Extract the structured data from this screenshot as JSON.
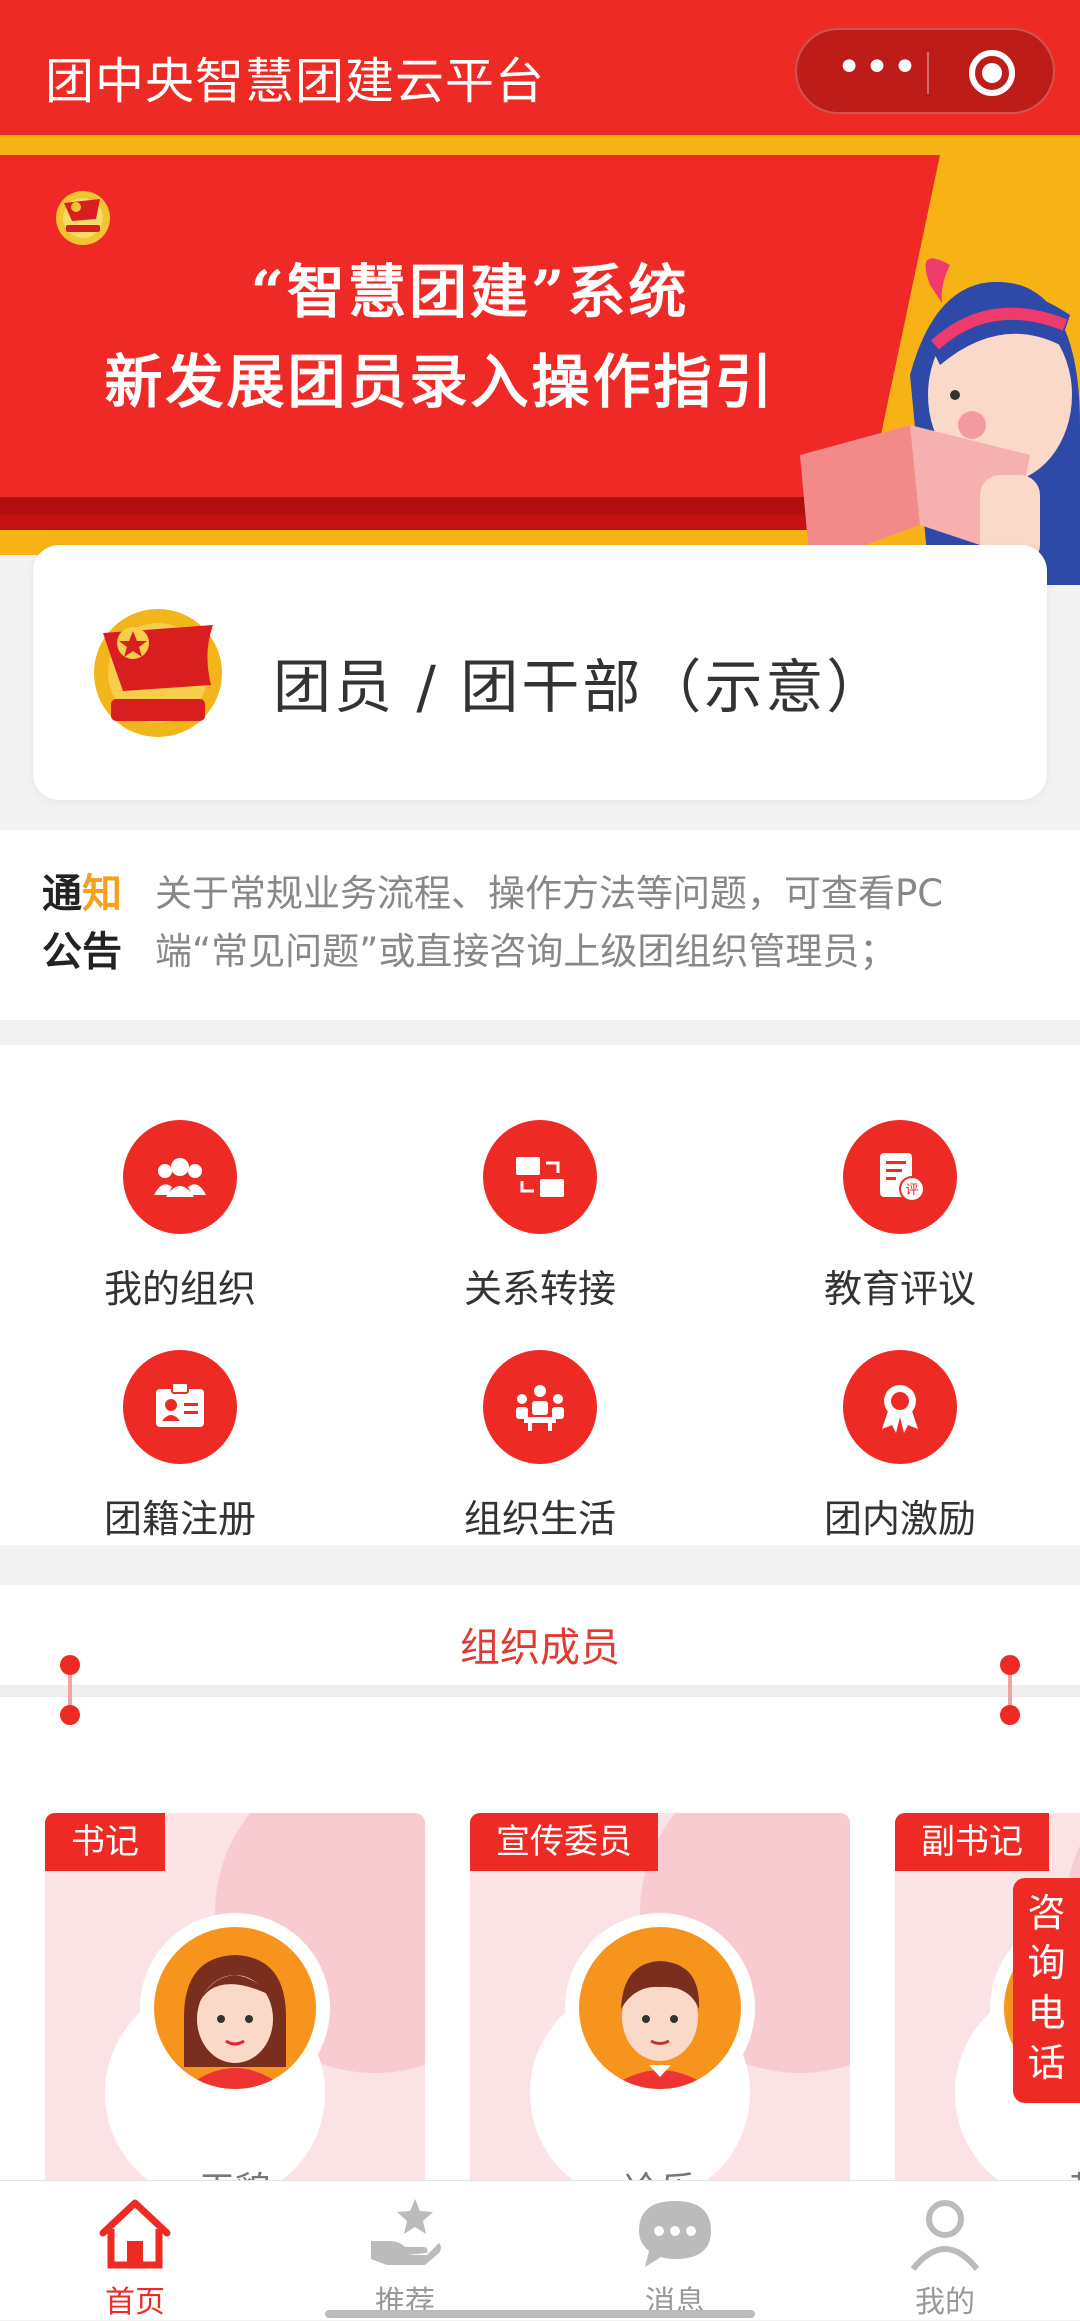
{
  "app": {
    "title": "团中央智慧团建云平台"
  },
  "banner": {
    "line1": "“智慧团建”系统",
    "line2": "新发展团员录入操作指引"
  },
  "profile": {
    "name": "团员 / 团干部（示意）"
  },
  "notice": {
    "tag_part1": "通",
    "tag_part2": "知",
    "tag_part3": "公告",
    "text": "关于常规业务流程、操作方法等问题，可查看PC端“常见问题”或直接咨询上级团组织管理员；"
  },
  "grid": [
    {
      "label": "我的组织",
      "icon": "people-group-icon"
    },
    {
      "label": "关系转接",
      "icon": "folder-transfer-icon"
    },
    {
      "label": "教育评议",
      "icon": "evaluation-doc-icon"
    },
    {
      "label": "团籍注册",
      "icon": "id-card-icon"
    },
    {
      "label": "组织生活",
      "icon": "meeting-icon"
    },
    {
      "label": "团内激励",
      "icon": "award-ribbon-icon"
    }
  ],
  "members": {
    "title": "组织成员",
    "cards": [
      {
        "role": "书记",
        "name": "王貌"
      },
      {
        "role": "宣传委员",
        "name": "冷乐"
      },
      {
        "role": "副书记",
        "name": "黄"
      }
    ]
  },
  "consult": {
    "label": "咨询电话"
  },
  "tabs": [
    {
      "label": "首页",
      "icon": "home-icon",
      "active": true
    },
    {
      "label": "推荐",
      "icon": "hand-star-icon",
      "active": false
    },
    {
      "label": "消息",
      "icon": "chat-bubble-icon",
      "active": false
    },
    {
      "label": "我的",
      "icon": "user-icon",
      "active": false
    }
  ],
  "colors": {
    "primary": "#ee2a24",
    "banner_yellow": "#f7b316",
    "notice_accent": "#f4a020"
  }
}
